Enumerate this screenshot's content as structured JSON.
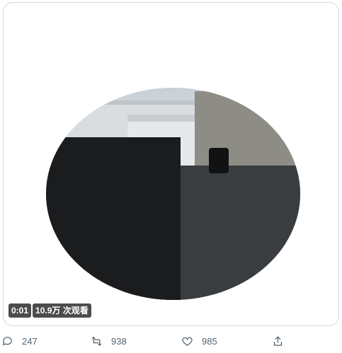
{
  "media": {
    "time": "0:01",
    "views": "10.9万 次观看"
  },
  "actions": {
    "replies": "247",
    "retweets": "938",
    "likes": "985"
  }
}
